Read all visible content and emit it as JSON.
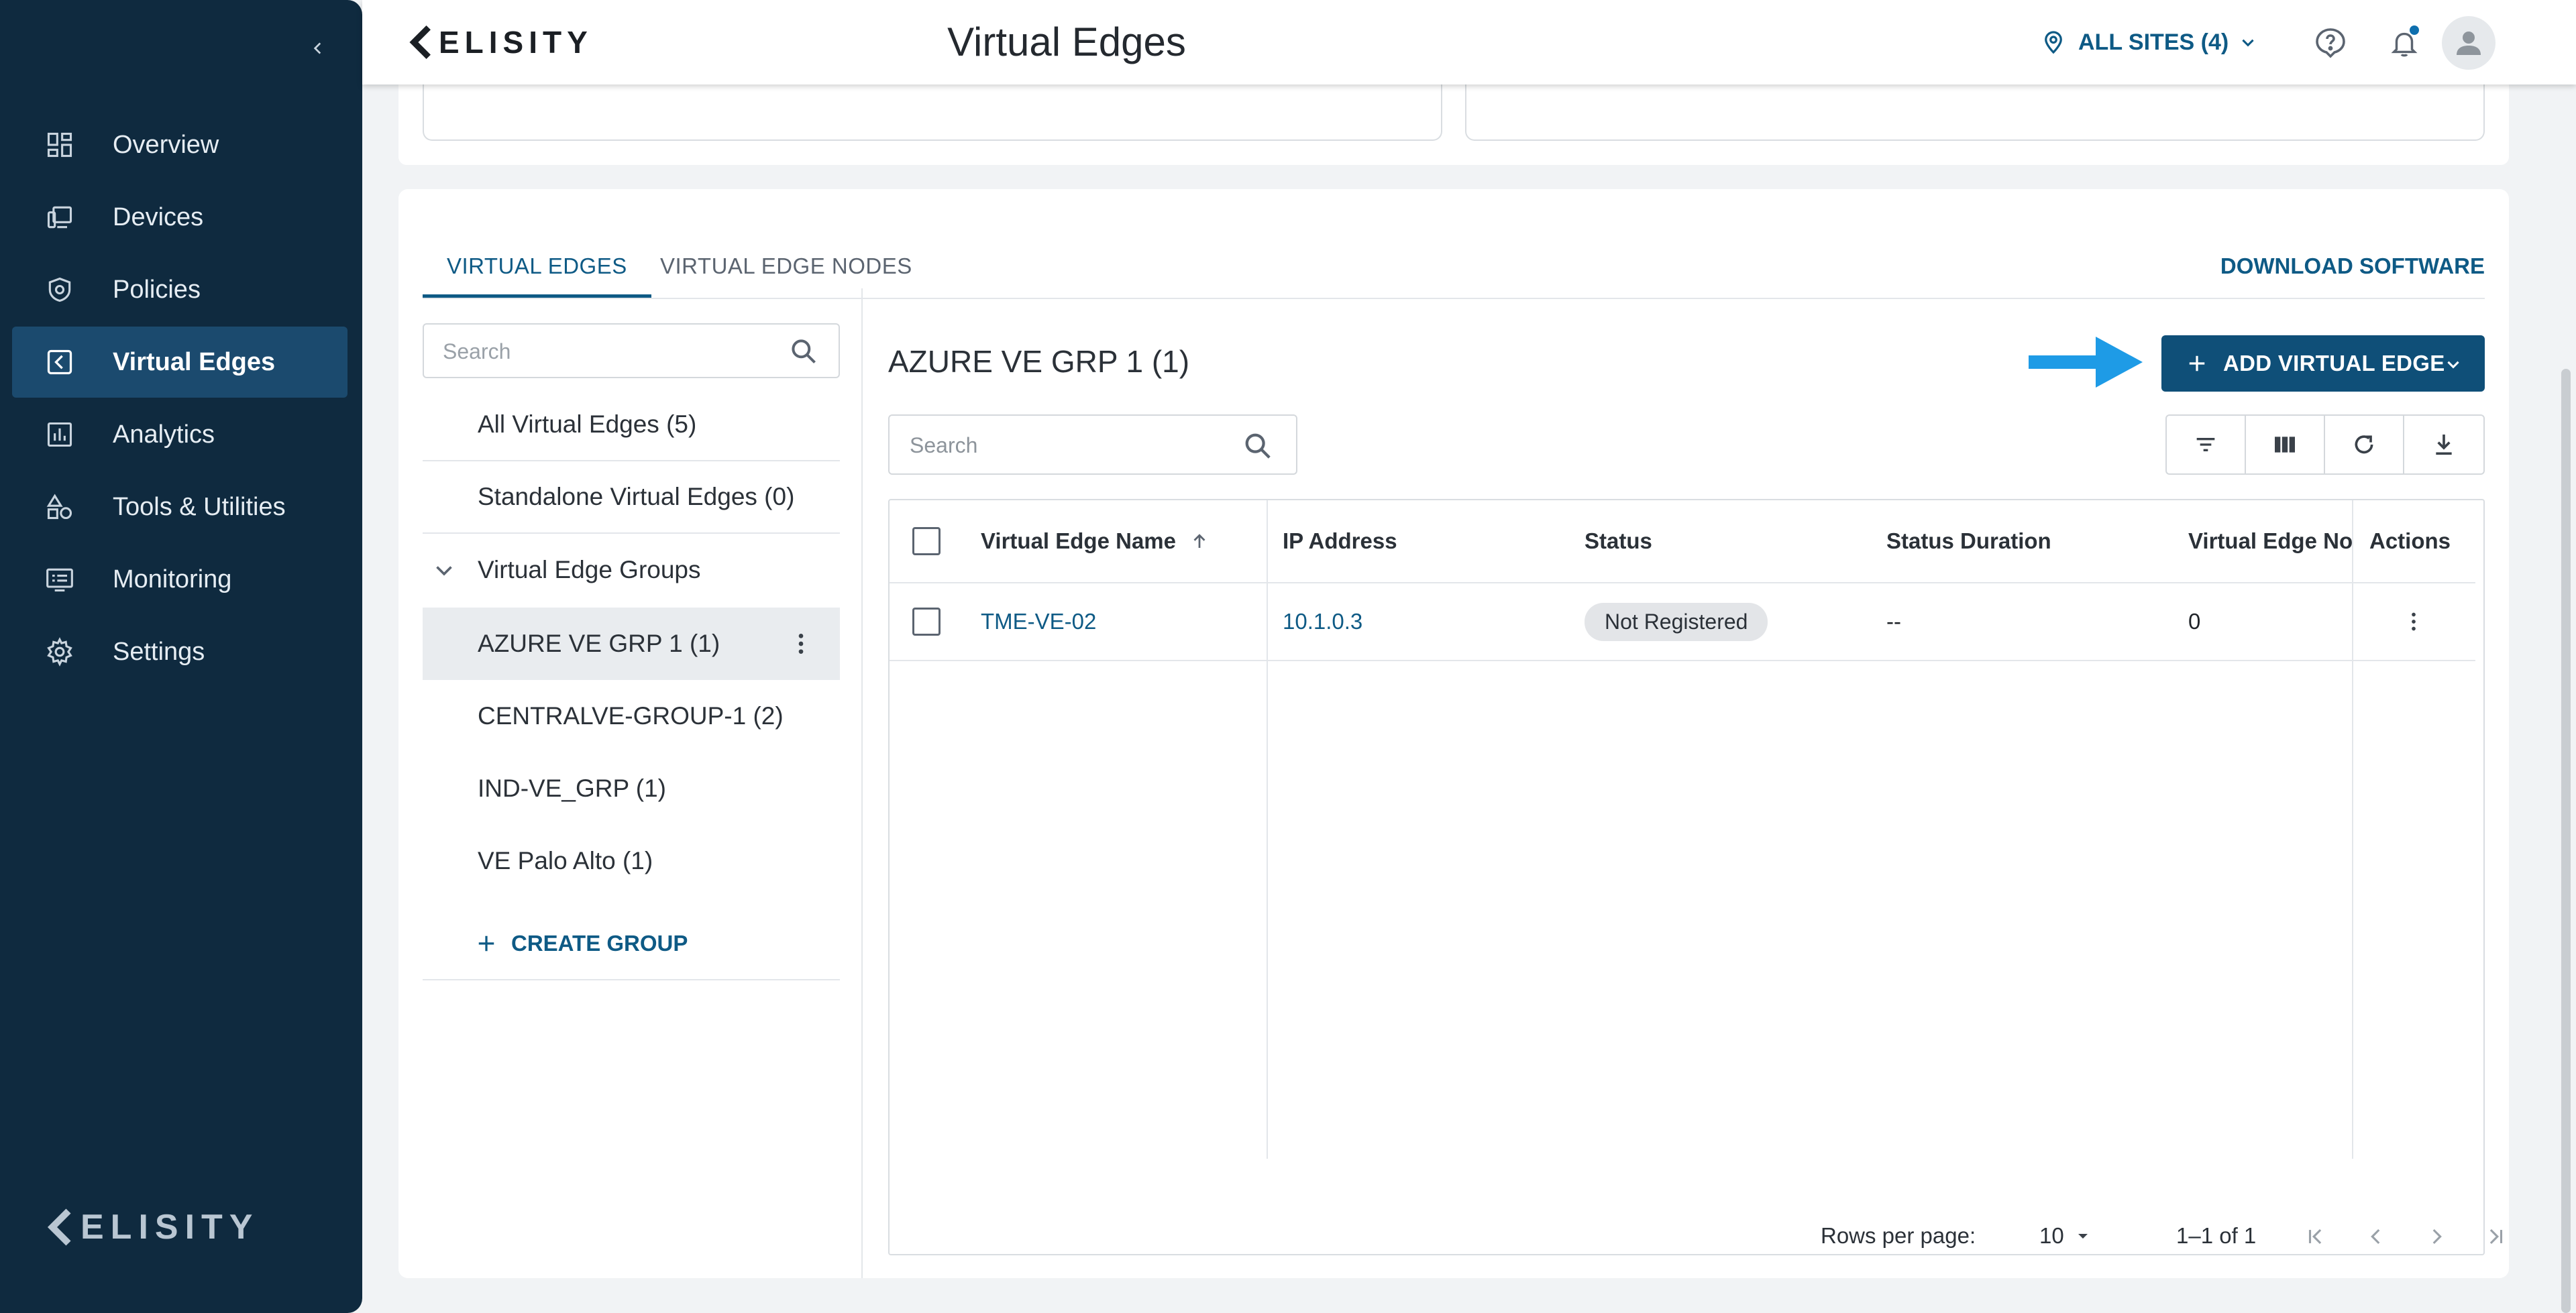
{
  "app": {
    "brand": "ELISITY",
    "page_title": "Virtual Edges"
  },
  "header": {
    "sites_label": "ALL SITES (4)",
    "icons": [
      "location-pin-icon",
      "chevron-down-icon",
      "help-icon",
      "bell-icon",
      "user-avatar-icon"
    ]
  },
  "sidebar": {
    "items": [
      {
        "label": "Overview",
        "icon": "dashboard-icon"
      },
      {
        "label": "Devices",
        "icon": "devices-icon"
      },
      {
        "label": "Policies",
        "icon": "shield-icon"
      },
      {
        "label": "Virtual Edges",
        "icon": "virtual-edge-icon",
        "active": true
      },
      {
        "label": "Analytics",
        "icon": "analytics-icon"
      },
      {
        "label": "Tools & Utilities",
        "icon": "tools-icon"
      },
      {
        "label": "Monitoring",
        "icon": "monitor-icon"
      },
      {
        "label": "Settings",
        "icon": "gear-icon"
      }
    ],
    "footer_brand": "ELISITY"
  },
  "tabs": [
    {
      "label": "VIRTUAL EDGES",
      "active": true
    },
    {
      "label": "VIRTUAL EDGE NODES",
      "active": false
    }
  ],
  "download_label": "DOWNLOAD SOFTWARE",
  "groups_panel": {
    "search_placeholder": "Search",
    "all_label": "All Virtual Edges (5)",
    "standalone_label": "Standalone Virtual Edges (0)",
    "groups_header": "Virtual Edge Groups",
    "groups": [
      {
        "label": "AZURE VE GRP 1 (1)",
        "selected": true
      },
      {
        "label": "CENTRALVE-GROUP-1 (2)"
      },
      {
        "label": "IND-VE_GRP (1)"
      },
      {
        "label": "VE Palo Alto (1)"
      }
    ],
    "create_label": "CREATE GROUP"
  },
  "content": {
    "group_title": "AZURE VE GRP 1 (1)",
    "add_button_label": "ADD VIRTUAL EDGE",
    "search_placeholder": "Search",
    "toolbar_icons": [
      "filter-icon",
      "columns-icon",
      "refresh-icon",
      "download-icon"
    ],
    "table": {
      "columns": [
        "Virtual Edge Name",
        "IP Address",
        "Status",
        "Status Duration",
        "Virtual Edge Nod",
        "Actions"
      ],
      "sorted_column": "Virtual Edge Name",
      "rows": [
        {
          "name": "TME-VE-02",
          "ip": "10.1.0.3",
          "status": "Not Registered",
          "duration": "--",
          "nodes": "0"
        }
      ]
    },
    "pagination": {
      "rows_per_page_label": "Rows per page:",
      "rows_per_page": "10",
      "range": "1–1 of 1"
    }
  },
  "colors": {
    "sidebar_bg": "#0f2a3f",
    "sidebar_active": "#1b4a6e",
    "accent": "#0e5a85",
    "primary_button": "#0f4f78",
    "annotation_arrow": "#1e9be6"
  }
}
